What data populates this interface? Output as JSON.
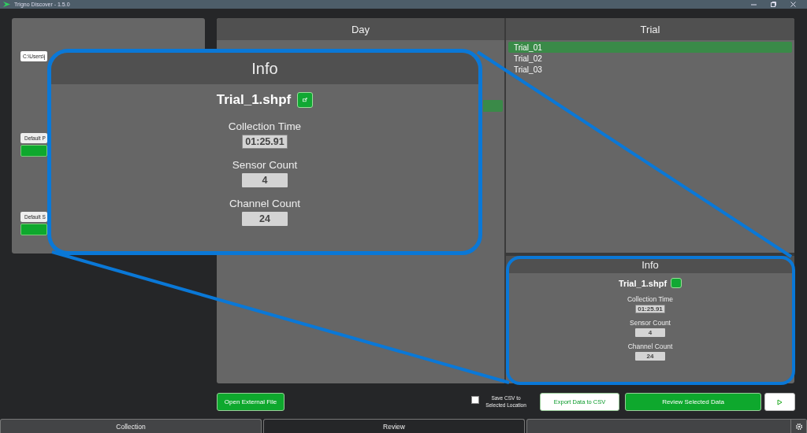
{
  "window": {
    "title": "Trigno Discover - 1.5.0"
  },
  "left_panel": {
    "path_field": {
      "value": "C:\\Users\\j"
    },
    "buttons": [
      {
        "label": "Default P"
      },
      {
        "label": "Default S"
      }
    ]
  },
  "day": {
    "title": "Day",
    "rows": [
      {
        "selected": true
      }
    ]
  },
  "trial": {
    "title": "Trial",
    "rows": [
      {
        "label": "Trial_01",
        "selected": true
      },
      {
        "label": "Trial_02",
        "selected": false
      },
      {
        "label": "Trial_03",
        "selected": false
      }
    ]
  },
  "info": {
    "title": "Info",
    "file": "Trial_1.shpf",
    "fields": [
      {
        "label": "Collection Time",
        "value": "01:25.91"
      },
      {
        "label": "Sensor Count",
        "value": "4"
      },
      {
        "label": "Channel Count",
        "value": "24"
      }
    ]
  },
  "callout": {
    "title": "Info",
    "file": "Trial_1.shpf",
    "fields": [
      {
        "label": "Collection Time",
        "value": "01:25.91"
      },
      {
        "label": "Sensor Count",
        "value": "4"
      },
      {
        "label": "Channel Count",
        "value": "24"
      }
    ]
  },
  "actions": {
    "open_button": "Open External File",
    "save_csv": {
      "label": "Save CSV to Selected Location",
      "checked": false
    },
    "export_button": "Export Data to CSV",
    "review_button": "Review Selected Data"
  },
  "tabs": [
    {
      "label": "Collection",
      "selected": false
    },
    {
      "label": "Review",
      "selected": true
    }
  ]
}
